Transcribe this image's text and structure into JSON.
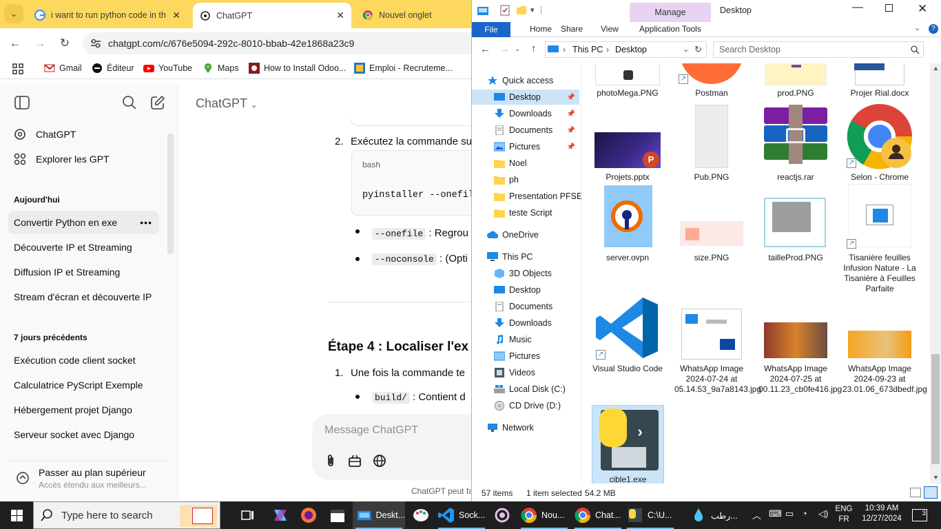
{
  "chrome": {
    "tabs": [
      {
        "title": "i want to run python code in th",
        "close": "✕"
      },
      {
        "title": "ChatGPT",
        "close": "✕"
      },
      {
        "title": "Nouvel onglet"
      }
    ],
    "url": "chatgpt.com/c/676e5094-292c-8010-bbab-42e1868a23c9",
    "bookmarks": [
      "Gmail",
      "Éditeur",
      "YouTube",
      "Maps",
      "How to Install Odoo...",
      "Emploi - Recruteme..."
    ]
  },
  "chatgpt": {
    "app_title": "ChatGPT",
    "nav": [
      "ChatGPT",
      "Explorer les GPT"
    ],
    "today_heading": "Aujourd'hui",
    "today_items": [
      "Convertir Python en exe",
      "Découverte IP et Streaming",
      "Diffusion IP et Streaming",
      "Stream d'écran et découverte IP"
    ],
    "week_heading": "7 jours précédents",
    "week_items": [
      "Exécution code client socket",
      "Calculatrice PyScript Exemple",
      "Hébergement projet Django",
      "Serveur socket avec Django"
    ],
    "upgrade_title": "Passer au plan supérieur",
    "upgrade_sub": "Accès étendu aux meilleurs...",
    "content": {
      "step2": "Exécutez la commande su",
      "step2_num": "2.",
      "code_lang": "bash",
      "code": "pyinstaller --onefile",
      "bullet1_code": "--onefile",
      "bullet1_text": ": Regrou",
      "bullet2_code": "--noconsole",
      "bullet2_text": ": (Opti",
      "step4_heading": "Étape 4 : Localiser l'ex",
      "step4_item": "Une fois la commande te",
      "step4_num": "1.",
      "bullet3_code": "build/",
      "bullet3_text": ": Contient d"
    },
    "message_placeholder": "Message ChatGPT",
    "footer": "ChatGPT peut fa"
  },
  "explorer": {
    "title": "Desktop",
    "manage_tab": "Manage",
    "ribbon_tabs": [
      "File",
      "Home",
      "Share",
      "View",
      "Application Tools"
    ],
    "address": [
      "This PC",
      "Desktop"
    ],
    "search_placeholder": "Search Desktop",
    "nav": {
      "quick_access": "Quick access",
      "quick_items": [
        "Desktop",
        "Downloads",
        "Documents",
        "Pictures",
        "Noel",
        "ph",
        "Presentation PFSEN",
        "teste Script"
      ],
      "onedrive": "OneDrive",
      "this_pc": "This PC",
      "pc_items": [
        "3D Objects",
        "Desktop",
        "Documents",
        "Downloads",
        "Music",
        "Pictures",
        "Videos",
        "Local Disk (C:)",
        "CD Drive (D:)"
      ],
      "network": "Network"
    },
    "files": [
      {
        "name": "photoMega.PNG"
      },
      {
        "name": "Postman"
      },
      {
        "name": "prod.PNG"
      },
      {
        "name": "Projer Rial.docx"
      },
      {
        "name": "Projets.pptx"
      },
      {
        "name": "Pub.PNG"
      },
      {
        "name": "reactjs.rar"
      },
      {
        "name": "Selon - Chrome"
      },
      {
        "name": "server.ovpn"
      },
      {
        "name": "size.PNG"
      },
      {
        "name": "tailleProd.PNG"
      },
      {
        "name": "Tisanière feuilles Infusion Nature - La Tisanière à Feuilles Parfaite"
      },
      {
        "name": "Visual Studio Code"
      },
      {
        "name": "WhatsApp Image 2024-07-24 at 05.14.53_9a7a8143.jpg"
      },
      {
        "name": "WhatsApp Image 2024-07-25 at 00.11.23_cb0fe416.jpg"
      },
      {
        "name": "WhatsApp Image 2024-09-23 at 23.01.06_673dbedf.jpg"
      },
      {
        "name": "cible1.exe"
      }
    ],
    "status": {
      "items": "57 items",
      "selected": "1 item selected",
      "size": "54.2 MB"
    }
  },
  "taskbar": {
    "search_placeholder": "Type here to search",
    "apps": [
      "Deskt...",
      "Sock...",
      "Nou...",
      "Chat...",
      "C:\\U...",
      "رطب..."
    ],
    "lang1": "ENG",
    "lang2": "FR",
    "time": "10:39 AM",
    "date": "12/27/2024",
    "notif_count": "3"
  }
}
